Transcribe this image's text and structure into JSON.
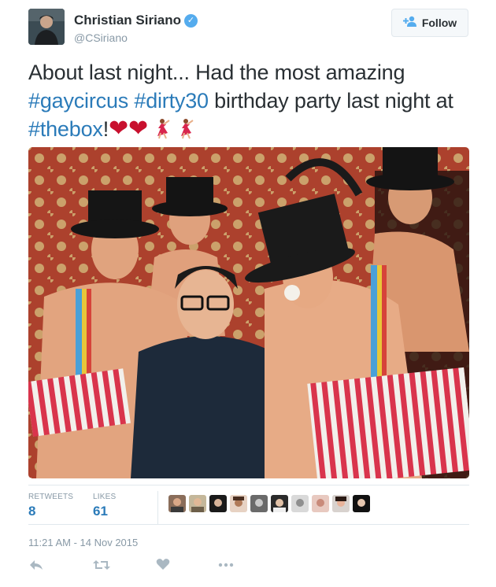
{
  "author": {
    "name": "Christian Siriano",
    "handle": "@CSiriano",
    "verified_mark": "✓"
  },
  "follow_button": {
    "label": "Follow",
    "icon": "follow-person-plus-icon"
  },
  "tweet": {
    "text_1": "About last night... Had the most amazing",
    "hashtag_1": "#gaycircus",
    "hashtag_2": "#dirty30",
    "text_2": "birthday party last night at",
    "hashtag_3": "#thebox",
    "text_3": "!",
    "emoji": [
      "red-heart",
      "red-heart",
      "dancer",
      "dancer"
    ]
  },
  "stats": {
    "retweets_label": "RETWEETS",
    "retweets_value": "8",
    "likes_label": "LIKES",
    "likes_value": "61"
  },
  "liker_avatars_count": 10,
  "timestamp": "11:21 AM - 14 Nov 2015",
  "actions": [
    "reply-icon",
    "retweet-icon",
    "like-heart-icon",
    "more-icon"
  ],
  "colors": {
    "link": "#2b7bb9",
    "verified": "#55acee",
    "muted": "#8899a6",
    "heart": "#c8102e"
  }
}
